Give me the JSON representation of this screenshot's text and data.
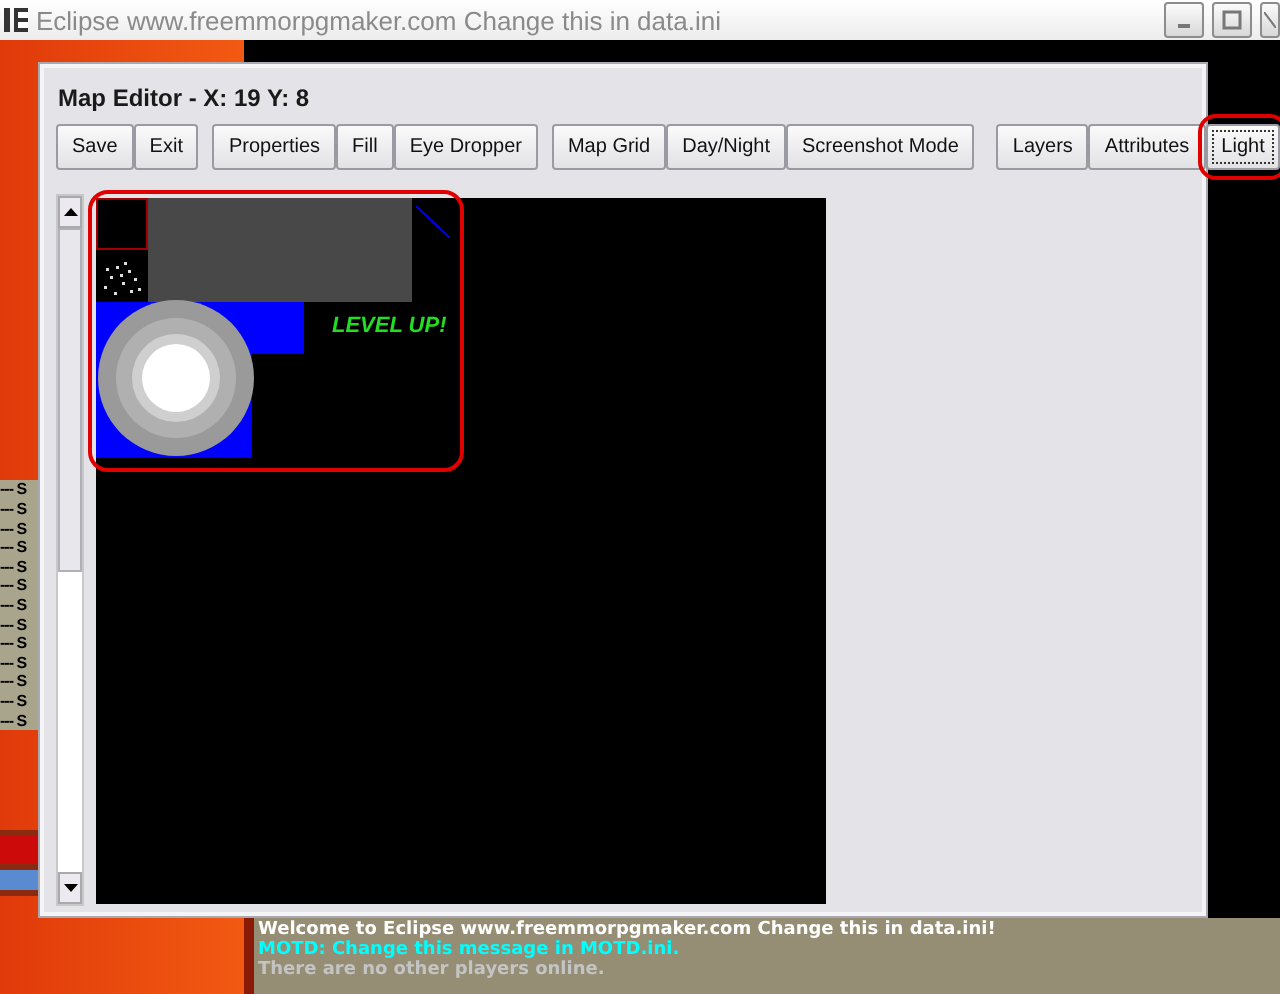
{
  "window": {
    "title": "Eclipse www.freemmorpgmaker.com Change this in data.ini"
  },
  "side_log": {
    "lines": [
      "--- S",
      "--- S",
      "--- S",
      "--- S",
      "--- S",
      "--- S",
      "--- S",
      "--- S",
      "--- S",
      "--- S",
      "--- S",
      "--- S",
      "--- S"
    ]
  },
  "map_editor": {
    "title": "Map Editor - X: 19 Y: 8",
    "toolbar": [
      [
        {
          "label": "Save",
          "selected": false,
          "highlighted": false
        },
        {
          "label": "Exit",
          "selected": false,
          "highlighted": false
        }
      ],
      [
        {
          "label": "Properties",
          "selected": false,
          "highlighted": false
        },
        {
          "label": "Fill",
          "selected": false,
          "highlighted": false
        },
        {
          "label": "Eye Dropper",
          "selected": false,
          "highlighted": false
        }
      ],
      [
        {
          "label": "Map Grid",
          "selected": false,
          "highlighted": false
        },
        {
          "label": "Day/Night",
          "selected": false,
          "highlighted": false
        },
        {
          "label": "Screenshot Mode",
          "selected": false,
          "highlighted": false
        }
      ],
      [
        {
          "label": "Layers",
          "selected": false,
          "highlighted": false
        },
        {
          "label": "Attributes",
          "selected": false,
          "highlighted": false
        },
        {
          "label": "Light",
          "selected": true,
          "highlighted": true
        }
      ]
    ],
    "map": {
      "highlighted": true,
      "floating_text": "LEVEL UP!"
    }
  },
  "chat": [
    {
      "text": "Welcome to Eclipse www.freemmorpgmaker.com Change this in data.ini!",
      "kind": "welcome"
    },
    {
      "text": "MOTD: Change this message in MOTD.ini.",
      "kind": "motd"
    },
    {
      "text": "There are no other players online.",
      "kind": "info"
    }
  ]
}
